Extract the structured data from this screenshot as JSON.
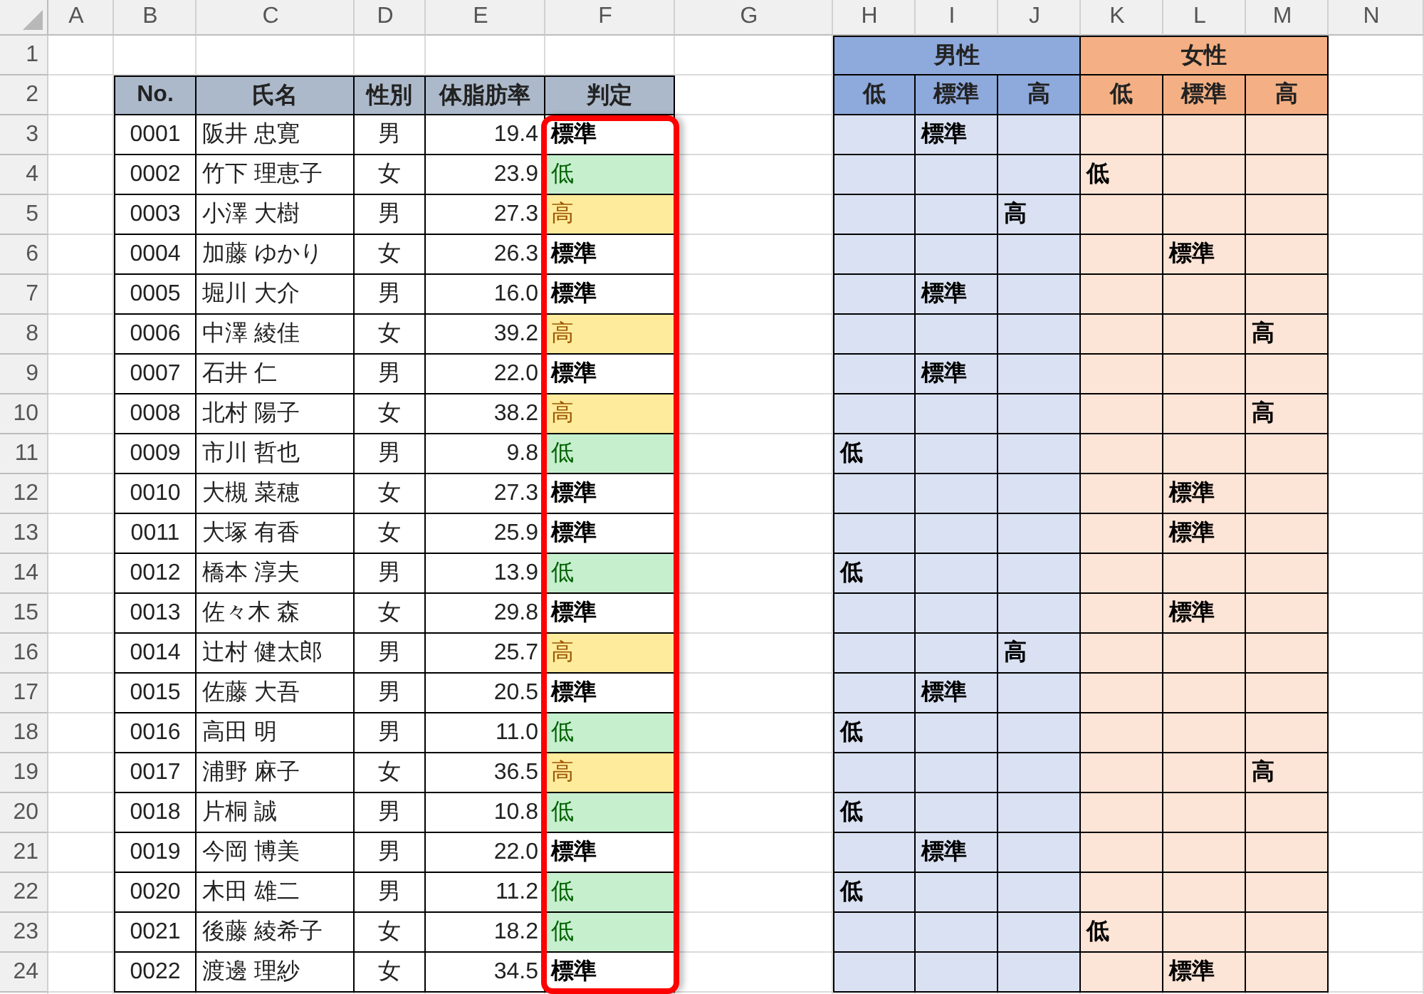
{
  "sheet": {
    "columns": [
      "A",
      "B",
      "C",
      "D",
      "E",
      "F",
      "G",
      "H",
      "I",
      "J",
      "K",
      "L",
      "M",
      "N"
    ],
    "row_numbers": [
      "1",
      "2",
      "3",
      "4",
      "5",
      "6",
      "7",
      "8",
      "9",
      "10",
      "11",
      "12",
      "13",
      "14",
      "15",
      "16",
      "17",
      "18",
      "19",
      "20",
      "21",
      "22",
      "23",
      "24"
    ]
  },
  "table": {
    "headers": [
      "No.",
      "氏名",
      "性別",
      "体脂肪率",
      "判定"
    ],
    "judgement_highlighted": true,
    "rows": [
      {
        "no": "0001",
        "name": "阪井 忠寛",
        "sex": "男",
        "rate": "19.4",
        "judgement": {
          "kind": "standard",
          "text": "標準"
        },
        "cross": {
          "kind": "male_standard",
          "text": "標準"
        }
      },
      {
        "no": "0002",
        "name": "竹下 理恵子",
        "sex": "女",
        "rate": "23.9",
        "judgement": {
          "kind": "low",
          "text": "低"
        },
        "cross": {
          "kind": "female_low",
          "text": "低"
        }
      },
      {
        "no": "0003",
        "name": "小澤 大樹",
        "sex": "男",
        "rate": "27.3",
        "judgement": {
          "kind": "high",
          "text": "高"
        },
        "cross": {
          "kind": "male_high",
          "text": "高"
        }
      },
      {
        "no": "0004",
        "name": "加藤 ゆかり",
        "sex": "女",
        "rate": "26.3",
        "judgement": {
          "kind": "standard",
          "text": "標準"
        },
        "cross": {
          "kind": "female_standard",
          "text": "標準"
        }
      },
      {
        "no": "0005",
        "name": "堀川 大介",
        "sex": "男",
        "rate": "16.0",
        "judgement": {
          "kind": "standard",
          "text": "標準"
        },
        "cross": {
          "kind": "male_standard",
          "text": "標準"
        }
      },
      {
        "no": "0006",
        "name": "中澤 綾佳",
        "sex": "女",
        "rate": "39.2",
        "judgement": {
          "kind": "high",
          "text": "高"
        },
        "cross": {
          "kind": "female_high",
          "text": "高"
        }
      },
      {
        "no": "0007",
        "name": "石井 仁",
        "sex": "男",
        "rate": "22.0",
        "judgement": {
          "kind": "standard",
          "text": "標準"
        },
        "cross": {
          "kind": "male_standard",
          "text": "標準"
        }
      },
      {
        "no": "0008",
        "name": "北村 陽子",
        "sex": "女",
        "rate": "38.2",
        "judgement": {
          "kind": "high",
          "text": "高"
        },
        "cross": {
          "kind": "female_high",
          "text": "高"
        }
      },
      {
        "no": "0009",
        "name": "市川 哲也",
        "sex": "男",
        "rate": "9.8",
        "judgement": {
          "kind": "low",
          "text": "低"
        },
        "cross": {
          "kind": "male_low",
          "text": "低"
        }
      },
      {
        "no": "0010",
        "name": "大槻 菜穂",
        "sex": "女",
        "rate": "27.3",
        "judgement": {
          "kind": "standard",
          "text": "標準"
        },
        "cross": {
          "kind": "female_standard",
          "text": "標準"
        }
      },
      {
        "no": "0011",
        "name": "大塚 有香",
        "sex": "女",
        "rate": "25.9",
        "judgement": {
          "kind": "standard",
          "text": "標準"
        },
        "cross": {
          "kind": "female_standard",
          "text": "標準"
        }
      },
      {
        "no": "0012",
        "name": "橋本 淳夫",
        "sex": "男",
        "rate": "13.9",
        "judgement": {
          "kind": "low",
          "text": "低"
        },
        "cross": {
          "kind": "male_low",
          "text": "低"
        }
      },
      {
        "no": "0013",
        "name": "佐々木 森",
        "sex": "女",
        "rate": "29.8",
        "judgement": {
          "kind": "standard",
          "text": "標準"
        },
        "cross": {
          "kind": "female_standard",
          "text": "標準"
        }
      },
      {
        "no": "0014",
        "name": "辻村 健太郎",
        "sex": "男",
        "rate": "25.7",
        "judgement": {
          "kind": "high",
          "text": "高"
        },
        "cross": {
          "kind": "male_high",
          "text": "高"
        }
      },
      {
        "no": "0015",
        "name": "佐藤 大吾",
        "sex": "男",
        "rate": "20.5",
        "judgement": {
          "kind": "standard",
          "text": "標準"
        },
        "cross": {
          "kind": "male_standard",
          "text": "標準"
        }
      },
      {
        "no": "0016",
        "name": "高田 明",
        "sex": "男",
        "rate": "11.0",
        "judgement": {
          "kind": "low",
          "text": "低"
        },
        "cross": {
          "kind": "male_low",
          "text": "低"
        }
      },
      {
        "no": "0017",
        "name": "浦野 麻子",
        "sex": "女",
        "rate": "36.5",
        "judgement": {
          "kind": "high",
          "text": "高"
        },
        "cross": {
          "kind": "female_high",
          "text": "高"
        }
      },
      {
        "no": "0018",
        "name": "片桐 誠",
        "sex": "男",
        "rate": "10.8",
        "judgement": {
          "kind": "low",
          "text": "低"
        },
        "cross": {
          "kind": "male_low",
          "text": "低"
        }
      },
      {
        "no": "0019",
        "name": "今岡 博美",
        "sex": "男",
        "rate": "22.0",
        "judgement": {
          "kind": "standard",
          "text": "標準"
        },
        "cross": {
          "kind": "male_standard",
          "text": "標準"
        }
      },
      {
        "no": "0020",
        "name": "木田 雄二",
        "sex": "男",
        "rate": "11.2",
        "judgement": {
          "kind": "low",
          "text": "低"
        },
        "cross": {
          "kind": "male_low",
          "text": "低"
        }
      },
      {
        "no": "0021",
        "name": "後藤 綾希子",
        "sex": "女",
        "rate": "18.2",
        "judgement": {
          "kind": "low",
          "text": "低"
        },
        "cross": {
          "kind": "female_low",
          "text": "低"
        }
      },
      {
        "no": "0022",
        "name": "渡邊 理紗",
        "sex": "女",
        "rate": "34.5",
        "judgement": {
          "kind": "standard",
          "text": "標準"
        },
        "cross": {
          "kind": "female_standard",
          "text": "標準"
        }
      }
    ]
  },
  "summary": {
    "groups": [
      {
        "kind": "male",
        "label": "男性",
        "columns": [
          "低",
          "標準",
          "高"
        ]
      },
      {
        "kind": "female",
        "label": "女性",
        "columns": [
          "低",
          "標準",
          "高"
        ]
      }
    ]
  }
}
